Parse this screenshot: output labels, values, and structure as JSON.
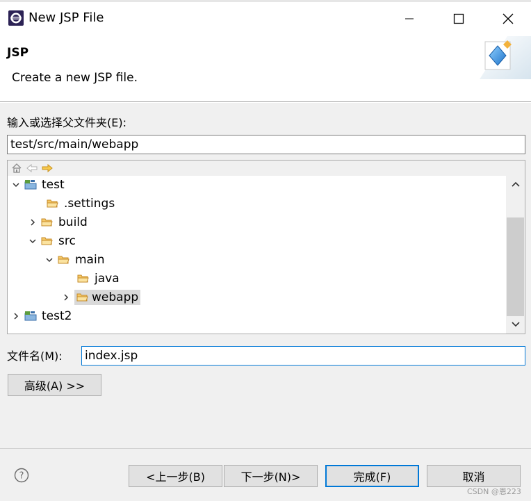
{
  "window": {
    "title": "New JSP File",
    "icons": {
      "app": "eclipse-icon",
      "minimize": "minimize-icon",
      "maximize": "maximize-icon",
      "close": "close-icon"
    }
  },
  "header": {
    "title": "JSP",
    "description": "Create a new JSP file.",
    "graphic": "jsp-wizard-graphic"
  },
  "parent_folder": {
    "label": "输入或选择父文件夹(E):",
    "value": "test/src/main/webapp"
  },
  "tree": {
    "toolbar": [
      "home-icon",
      "back-arrow-icon",
      "forward-arrow-icon"
    ],
    "items": [
      {
        "label": "test",
        "type": "project",
        "expanded": true
      },
      {
        "label": ".settings",
        "type": "folder"
      },
      {
        "label": "build",
        "type": "folder",
        "expanded": false
      },
      {
        "label": "src",
        "type": "folder",
        "expanded": true
      },
      {
        "label": "main",
        "type": "folder",
        "expanded": true
      },
      {
        "label": "java",
        "type": "folder"
      },
      {
        "label": "webapp",
        "type": "folder",
        "expanded": false,
        "selected": true
      },
      {
        "label": "test2",
        "type": "project",
        "expanded": false
      }
    ]
  },
  "file_name": {
    "label": "文件名(M):",
    "value": "index.jsp"
  },
  "advanced_label": "高级(A) >>",
  "footer": {
    "help_icon": "help-icon",
    "back_label": "<上一步(B)",
    "next_label": "下一步(N)>",
    "finish_label": "完成(F)",
    "cancel_label": "取消",
    "watermark": "CSDN @恩223"
  },
  "colors": {
    "accent": "#0078d7",
    "selection": "#d9d9d9",
    "folder": "#e8a33d",
    "panel_bg": "#f0f0f0"
  }
}
